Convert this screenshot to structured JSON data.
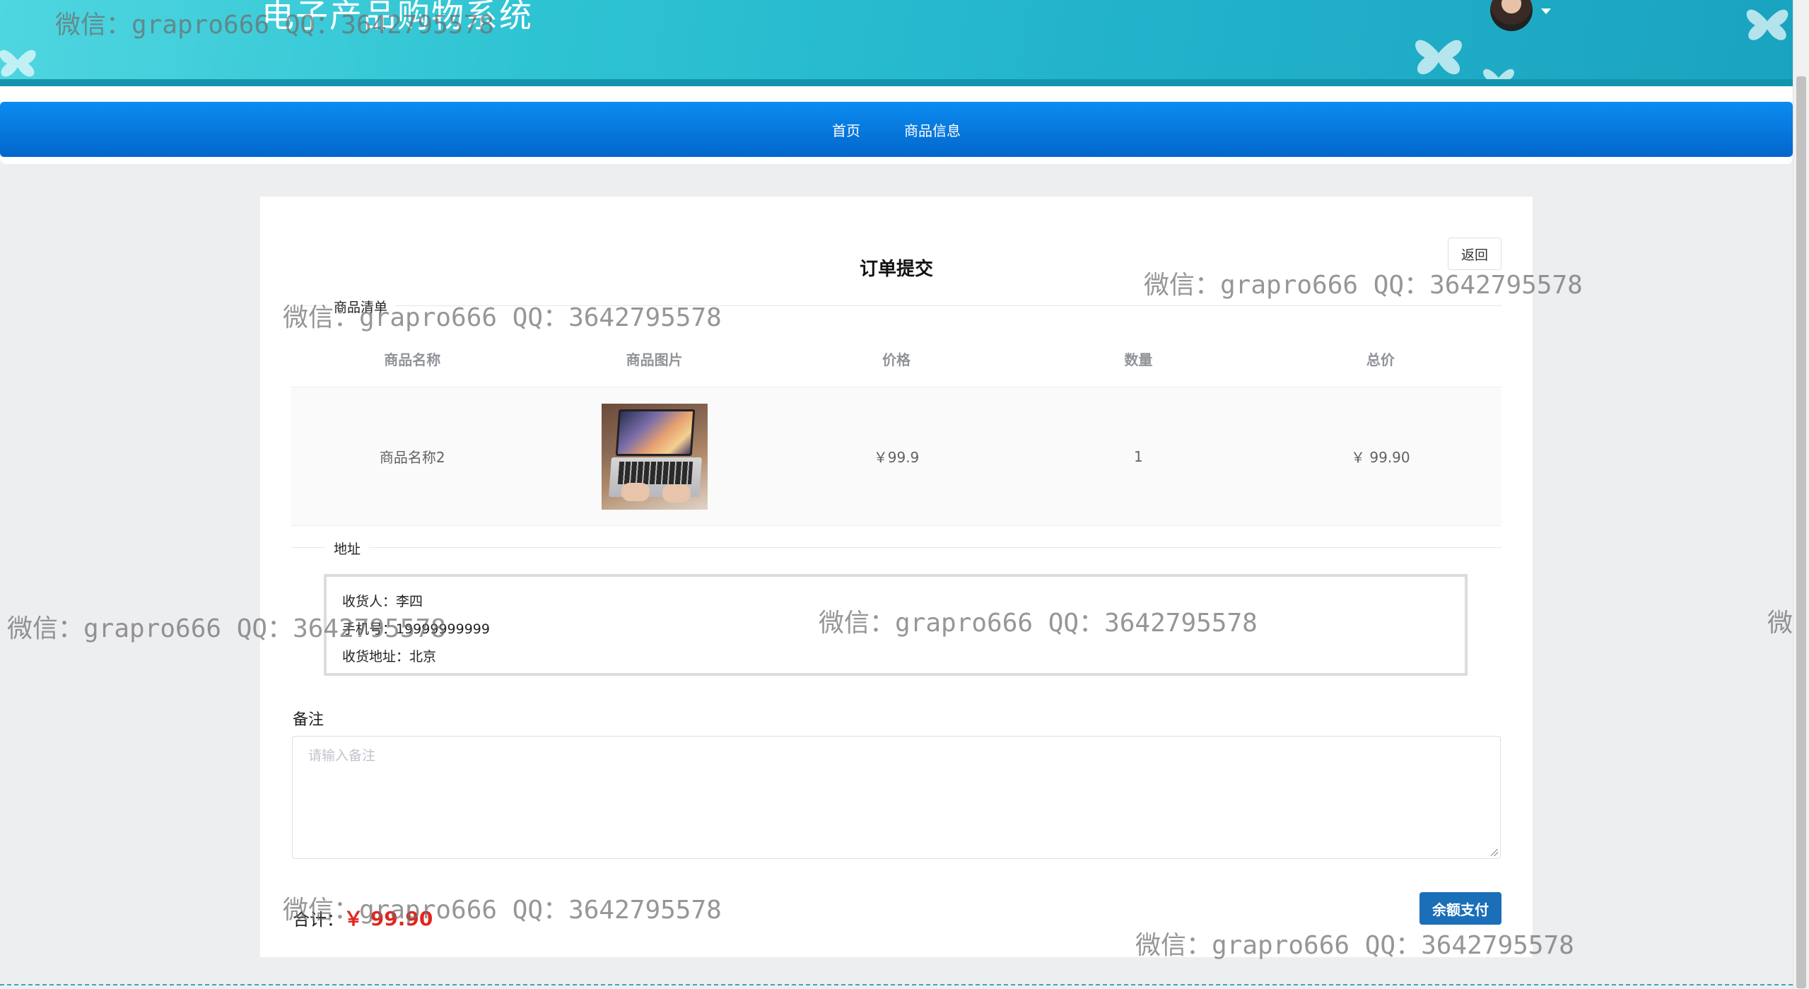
{
  "header": {
    "site_title": "电子产品购物系统"
  },
  "nav": {
    "items": [
      "首页",
      "商品信息"
    ]
  },
  "order": {
    "title": "订单提交",
    "back_label": "返回",
    "goods_section_label": "商品清单",
    "table": {
      "columns": [
        "商品名称",
        "商品图片",
        "价格",
        "数量",
        "总价"
      ],
      "rows": [
        {
          "name": "商品名称2",
          "price": "￥99.9",
          "quantity": "1",
          "total": "￥ 99.90"
        }
      ]
    },
    "address_section_label": "地址",
    "address": {
      "receiver": "收货人：李四",
      "phone": "手机号：19999999999",
      "location": "收货地址：北京"
    },
    "remark_label": "备注",
    "remark_placeholder": "请输入备注",
    "total_label": "合计：",
    "total_value": "￥ 99.90",
    "pay_label": "余额支付"
  },
  "watermark_text": "微信：grapro666 QQ：3642795578",
  "colors": {
    "nav_blue": "#0366cc",
    "pay_button": "#1a6fb8",
    "price_red": "#e0261d",
    "banner_teal": "#23b4cc"
  }
}
